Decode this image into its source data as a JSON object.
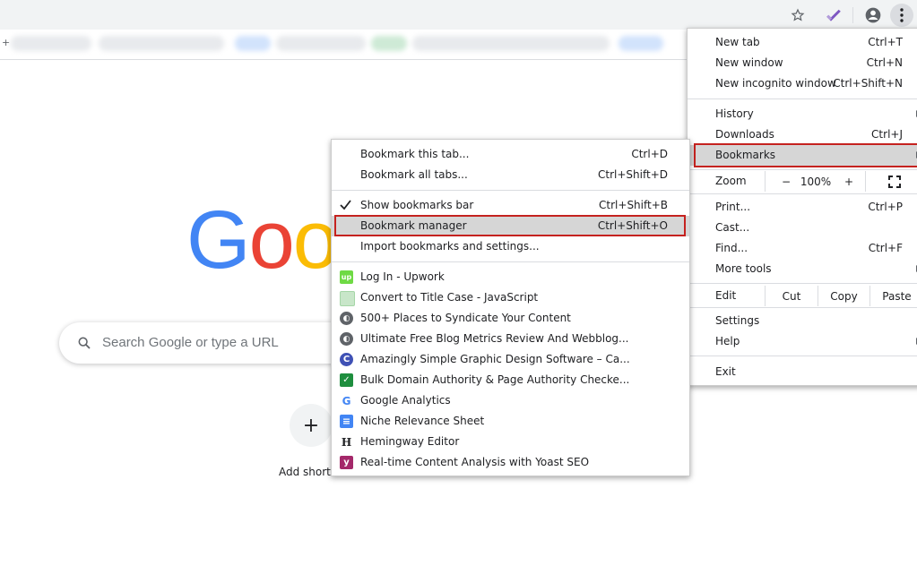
{
  "toolbar": {
    "star_icon": "star-icon",
    "extension_icon": "extension-check-icon",
    "profile_icon": "account-circle-icon",
    "menu_icon": "kebab-menu-icon"
  },
  "ntp": {
    "logo_text": "Goo",
    "search_placeholder": "Search Google or type a URL",
    "shortcut_plus": "+",
    "shortcut_label": "Add shortc"
  },
  "chrome_menu": {
    "new_tab": {
      "label": "New tab",
      "shortcut": "Ctrl+T"
    },
    "new_window": {
      "label": "New window",
      "shortcut": "Ctrl+N"
    },
    "new_incognito": {
      "label": "New incognito window",
      "shortcut": "Ctrl+Shift+N"
    },
    "history": {
      "label": "History"
    },
    "downloads": {
      "label": "Downloads",
      "shortcut": "Ctrl+J"
    },
    "bookmarks": {
      "label": "Bookmarks"
    },
    "zoom": {
      "label": "Zoom",
      "minus": "−",
      "value": "100%",
      "plus": "+"
    },
    "print": {
      "label": "Print...",
      "shortcut": "Ctrl+P"
    },
    "cast": {
      "label": "Cast..."
    },
    "find": {
      "label": "Find...",
      "shortcut": "Ctrl+F"
    },
    "more_tools": {
      "label": "More tools"
    },
    "edit": {
      "label": "Edit",
      "cut": "Cut",
      "copy": "Copy",
      "paste": "Paste"
    },
    "settings": {
      "label": "Settings"
    },
    "help": {
      "label": "Help"
    },
    "exit": {
      "label": "Exit"
    }
  },
  "bookmarks_menu": {
    "bookmark_tab": {
      "label": "Bookmark this tab...",
      "shortcut": "Ctrl+D"
    },
    "bookmark_all": {
      "label": "Bookmark all tabs...",
      "shortcut": "Ctrl+Shift+D"
    },
    "show_bar": {
      "label": "Show bookmarks bar",
      "shortcut": "Ctrl+Shift+B",
      "checked": true
    },
    "manager": {
      "label": "Bookmark manager",
      "shortcut": "Ctrl+Shift+O"
    },
    "import": {
      "label": "Import bookmarks and settings..."
    },
    "items": [
      {
        "label": "Log In - Upwork",
        "icon": "upwork-icon"
      },
      {
        "label": "Convert to Title Case - JavaScript",
        "icon": "page-icon"
      },
      {
        "label": "500+ Places to Syndicate Your Content",
        "icon": "globe-icon"
      },
      {
        "label": "Ultimate Free Blog Metrics Review And Webblog...",
        "icon": "globe-icon"
      },
      {
        "label": "Amazingly Simple Graphic Design Software – Ca...",
        "icon": "canva-icon"
      },
      {
        "label": "Bulk Domain Authority & Page Authority Checke...",
        "icon": "check-icon"
      },
      {
        "label": "Google Analytics",
        "icon": "google-icon"
      },
      {
        "label": "Niche Relevance Sheet",
        "icon": "sheet-icon"
      },
      {
        "label": "Hemingway Editor",
        "icon": "hemingway-icon"
      },
      {
        "label": "Real-time Content Analysis with Yoast SEO",
        "icon": "yoast-icon"
      }
    ]
  }
}
